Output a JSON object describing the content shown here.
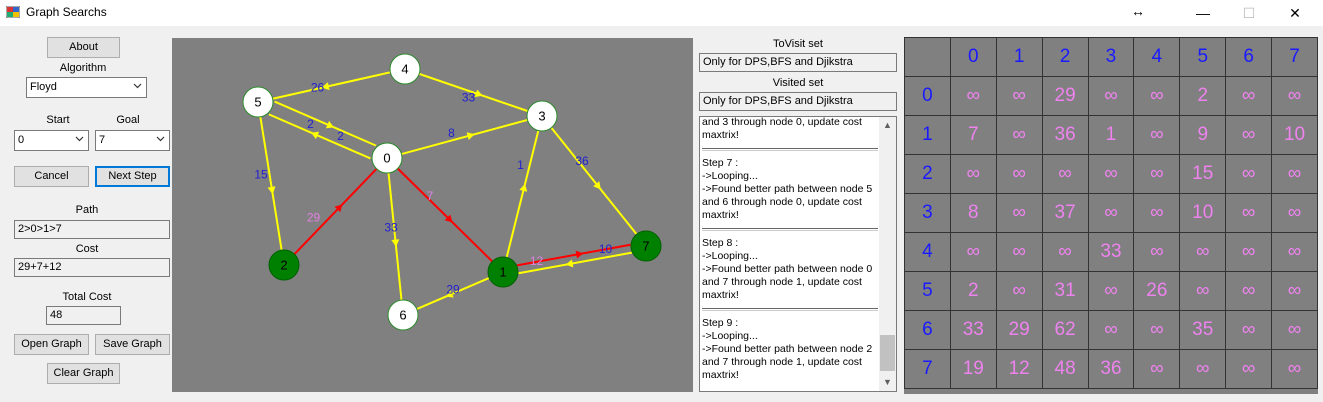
{
  "window": {
    "title": "Graph Searchs",
    "resize_glyph": "↔",
    "minimize": "—",
    "maximize": "☐",
    "close": "✕"
  },
  "controls": {
    "about": "About",
    "algorithm_label": "Algorithm",
    "algorithm_value": "Floyd",
    "start_label": "Start",
    "start_value": "0",
    "goal_label": "Goal",
    "goal_value": "7",
    "cancel": "Cancel",
    "next_step": "Next Step",
    "path_label": "Path",
    "path_value": "2>0>1>7",
    "cost_label": "Cost",
    "cost_value": "29+7+12",
    "total_cost_label": "Total Cost",
    "total_cost_value": "48",
    "open_graph": "Open Graph",
    "save_graph": "Save Graph",
    "clear_graph": "Clear Graph"
  },
  "sets": {
    "tovisit_label": "ToVisit set",
    "tovisit_value": "Only for DPS,BFS and Djikstra",
    "visited_label": "Visited set",
    "visited_value": "Only for DPS,BFS and Djikstra"
  },
  "log": {
    "entries": [
      "and 3 through node 0, update cost maxtrix!",
      "Step 7 :\n->Looping...\n->Found better path between node 5 and 6 through node 0, update cost maxtrix!",
      "Step 8 :\n->Looping...\n->Found better path between node 0 and 7 through node 1, update cost maxtrix!",
      "Step 9 :\n->Looping...\n->Found better path between node 2 and 7 through node 1, update cost maxtrix!"
    ]
  },
  "graph": {
    "colors": {
      "edge": "#ffff00",
      "path_edge": "#ff0000",
      "node_fill": "#ffffff",
      "path_node_fill": "#008000",
      "weight": "#2020d0",
      "path_weight": "#e080e0"
    },
    "nodes": [
      {
        "id": "0",
        "on_path": false
      },
      {
        "id": "1",
        "on_path": true
      },
      {
        "id": "2",
        "on_path": true
      },
      {
        "id": "3",
        "on_path": false
      },
      {
        "id": "4",
        "on_path": false
      },
      {
        "id": "5",
        "on_path": false
      },
      {
        "id": "6",
        "on_path": false
      },
      {
        "id": "7",
        "on_path": true
      }
    ],
    "edges": [
      {
        "from": "4",
        "to": "5",
        "weight": "26",
        "on_path": false
      },
      {
        "from": "4",
        "to": "3",
        "weight": "33",
        "on_path": false
      },
      {
        "from": "5",
        "to": "0",
        "weight": "2",
        "on_path": false
      },
      {
        "from": "0",
        "to": "5",
        "weight": "2",
        "on_path": false
      },
      {
        "from": "5",
        "to": "2",
        "weight": "15",
        "on_path": false
      },
      {
        "from": "0",
        "to": "3",
        "weight": "8",
        "on_path": false
      },
      {
        "from": "1",
        "to": "3",
        "weight": "1",
        "on_path": false
      },
      {
        "from": "3",
        "to": "7",
        "weight": "36",
        "on_path": false
      },
      {
        "from": "0",
        "to": "6",
        "weight": "33",
        "on_path": false
      },
      {
        "from": "1",
        "to": "6",
        "weight": "29",
        "on_path": false
      },
      {
        "from": "2",
        "to": "0",
        "weight": "29",
        "on_path": true
      },
      {
        "from": "0",
        "to": "1",
        "weight": "7",
        "on_path": true
      },
      {
        "from": "1",
        "to": "7",
        "weight": "12",
        "on_path": true
      },
      {
        "from": "7",
        "to": "1",
        "weight": "10",
        "on_path": false
      }
    ]
  },
  "matrix": {
    "headers": [
      "0",
      "1",
      "2",
      "3",
      "4",
      "5",
      "6",
      "7"
    ],
    "rows": [
      [
        "∞",
        "∞",
        "29",
        "∞",
        "∞",
        "2",
        "∞",
        "∞"
      ],
      [
        "7",
        "∞",
        "36",
        "1",
        "∞",
        "9",
        "∞",
        "10"
      ],
      [
        "∞",
        "∞",
        "∞",
        "∞",
        "∞",
        "15",
        "∞",
        "∞"
      ],
      [
        "8",
        "∞",
        "37",
        "∞",
        "∞",
        "10",
        "∞",
        "∞"
      ],
      [
        "∞",
        "∞",
        "∞",
        "33",
        "∞",
        "∞",
        "∞",
        "∞"
      ],
      [
        "2",
        "∞",
        "31",
        "∞",
        "26",
        "∞",
        "∞",
        "∞"
      ],
      [
        "33",
        "29",
        "62",
        "∞",
        "∞",
        "35",
        "∞",
        "∞"
      ],
      [
        "19",
        "12",
        "48",
        "36",
        "∞",
        "∞",
        "∞",
        "∞"
      ]
    ]
  }
}
